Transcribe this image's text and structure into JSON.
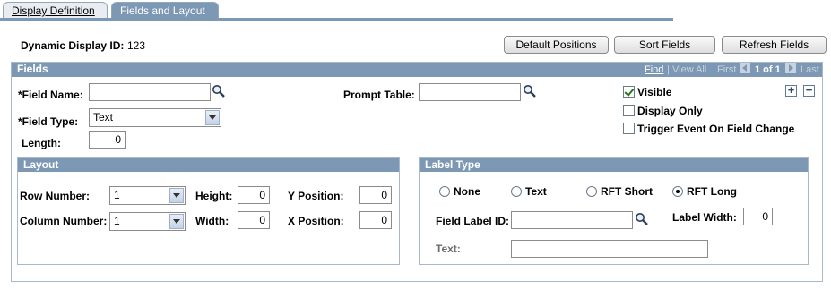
{
  "tabs": [
    {
      "label": "Display Definition",
      "active": false
    },
    {
      "label": "Fields and Layout",
      "active": true
    }
  ],
  "header": {
    "dynamic_display_id_label": "Dynamic Display ID:",
    "dynamic_display_id_value": "123"
  },
  "toolbar": {
    "default_positions": "Default Positions",
    "sort_fields": "Sort Fields",
    "refresh_fields": "Refresh Fields"
  },
  "fields_section": {
    "title": "Fields",
    "nav": {
      "find": "Find",
      "separator": "|",
      "view_all": "View All",
      "first": "First",
      "count": "1 of 1",
      "last": "Last"
    },
    "field_name_label": "*Field Name:",
    "field_name_value": "",
    "field_type_label": "*Field Type:",
    "field_type_value": "Text",
    "length_label": "Length:",
    "length_value": "0",
    "prompt_table_label": "Prompt Table:",
    "prompt_table_value": "",
    "visible_label": "Visible",
    "visible_checked": true,
    "display_only_label": "Display Only",
    "display_only_checked": false,
    "trigger_label": "Trigger Event On Field Change",
    "trigger_checked": false,
    "add_row": "+",
    "delete_row": "−"
  },
  "layout": {
    "title": "Layout",
    "row_number_label": "Row Number:",
    "row_number_value": "1",
    "column_number_label": "Column Number:",
    "column_number_value": "1",
    "height_label": "Height:",
    "height_value": "0",
    "width_label": "Width:",
    "width_value": "0",
    "y_position_label": "Y Position:",
    "y_position_value": "0",
    "x_position_label": "X Position:",
    "x_position_value": "0"
  },
  "label_type": {
    "title": "Label Type",
    "options": [
      "None",
      "Text",
      "RFT Short",
      "RFT Long"
    ],
    "selected": "RFT Long",
    "field_label_id_label": "Field Label ID:",
    "field_label_id_value": "",
    "label_width_label": "Label Width:",
    "label_width_value": "0",
    "text_label": "Text:",
    "text_value": ""
  },
  "icons": {
    "lookup": "magnifier-icon",
    "first": "left-arrow-icon",
    "last": "right-arrow-icon"
  },
  "colors": {
    "accent": "#7c98b4",
    "link": "#1f4e8c"
  }
}
